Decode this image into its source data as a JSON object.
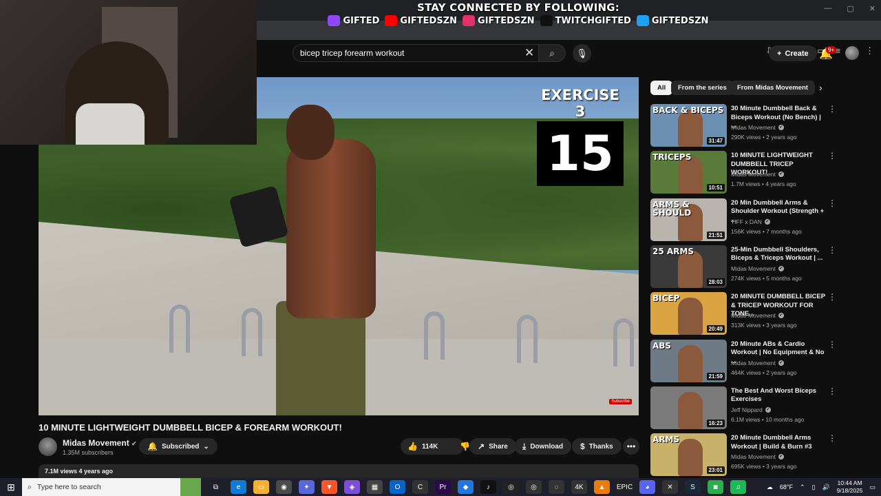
{
  "browser": {
    "window_controls": [
      "—",
      "▢",
      "✕"
    ],
    "toolbar_icons": [
      "install-icon",
      "star-icon",
      "extensions-icon",
      "cast-icon",
      "menu-icon"
    ]
  },
  "overlay": {
    "banner_title": "STAY CONNECTED BY FOLLOWING:",
    "socials": [
      {
        "platform": "twitch-icon",
        "handle": "GIFTED",
        "color": "#9146ff"
      },
      {
        "platform": "youtube-icon",
        "handle": "GIFTEDSZN",
        "color": "#ff0000"
      },
      {
        "platform": "instagram-icon",
        "handle": "GIFTEDSZN",
        "color": "#e1306c"
      },
      {
        "platform": "tiktok-icon",
        "handle": "TWITCHGIFTED",
        "color": "#111111"
      },
      {
        "platform": "twitter-icon",
        "handle": "GIFTEDSZN",
        "color": "#1da1f2"
      }
    ]
  },
  "header": {
    "search_query": "bicep tricep forearm workout",
    "clear_glyph": "✕",
    "search_glyph": "⌕",
    "mic_glyph": "🎙",
    "create_label": "Create",
    "create_glyph": "+",
    "notif_badge": "9+",
    "bell_glyph": "🔔"
  },
  "video": {
    "exercise_label": "EXERCISE 3",
    "exercise_count": "15",
    "watermark": "Subscribe",
    "title": "10 MINUTE LIGHTWEIGHT DUMBBELL BICEP & FOREARM WORKOUT!",
    "channel": "Midas Movement",
    "subscribers": "1.35M subscribers",
    "subscribed_label": "Subscribed",
    "likes": "114K",
    "share_label": "Share",
    "download_label": "Download",
    "thanks_label": "Thanks",
    "more_glyph": "•••",
    "views_line": "7.1M views  4 years ago"
  },
  "sidebar": {
    "chips": [
      "All",
      "From the series",
      "From Midas Movement"
    ],
    "next_glyph": "›",
    "recommendations": [
      {
        "title": "30 Minute Dumbbell Back & Biceps Workout (No Bench) | ...",
        "channel": "Midas Movement",
        "meta": "290K views • 2 years ago",
        "duration": "31:47",
        "thumb_text": "BACK & BICEPS",
        "thumb_bg": "#6b8fb0"
      },
      {
        "title": "10 MINUTE LIGHTWEIGHT DUMBBELL TRICEP WORKOUT!",
        "channel": "Midas Movement",
        "meta": "1.7M views • 4 years ago",
        "duration": "10:51",
        "thumb_text": "TRICEPS",
        "thumb_bg": "#5a7a3a"
      },
      {
        "title": "20 Min Dumbbell Arms & Shoulder Workout (Strength + ...",
        "channel": "TIFF x DAN",
        "meta": "156K views • 7 months ago",
        "duration": "21:51",
        "thumb_text": "ARMS & SHOULD",
        "thumb_bg": "#b9b4ad"
      },
      {
        "title": "25-Min Dumbbell Shoulders, Biceps & Triceps Workout | ...",
        "channel": "Midas Movement",
        "meta": "274K views • 5 months ago",
        "duration": "28:03",
        "thumb_text": "25 ARMS",
        "thumb_bg": "#3a3a3a"
      },
      {
        "title": "20 MINUTE DUMBBELL BICEP & TRICEP WORKOUT FOR TONE...",
        "channel": "Midas Movement",
        "meta": "313K views • 3 years ago",
        "duration": "20:49",
        "thumb_text": "BICEP",
        "thumb_bg": "#d9a441"
      },
      {
        "title": "20 Minute ABs & Cardio Workout | No Equipment & No ...",
        "channel": "Midas Movement",
        "meta": "464K views • 2 years ago",
        "duration": "21:59",
        "thumb_text": "ABS",
        "thumb_bg": "#6e7a86"
      },
      {
        "title": "The Best And Worst Biceps Exercises",
        "channel": "Jeff Nippard",
        "meta": "6.1M views • 10 months ago",
        "duration": "16:23",
        "thumb_text": "",
        "thumb_bg": "#7a7a7a"
      },
      {
        "title": "20 Minute Dumbbell Arms Workout | Build & Burn #3",
        "channel": "Midas Movement",
        "meta": "695K views • 3 years ago",
        "duration": "23:01",
        "thumb_text": "ARMS",
        "thumb_bg": "#c8b26a"
      }
    ]
  },
  "taskbar": {
    "search_placeholder": "Type here to search",
    "weather": "68°F",
    "time": "10:44 AM",
    "date": "9/18/2025",
    "apps": [
      {
        "name": "task-view-icon",
        "glyph": "⧉",
        "color": "#1f1f2b"
      },
      {
        "name": "edge-icon",
        "glyph": "e",
        "color": "#0f7bd6"
      },
      {
        "name": "file-explorer-icon",
        "glyph": "▭",
        "color": "#f2b134"
      },
      {
        "name": "chrome-icon",
        "glyph": "◉",
        "color": "#4a4a4a"
      },
      {
        "name": "copilot-icon",
        "glyph": "✦",
        "color": "#5a67d8"
      },
      {
        "name": "brave-icon",
        "glyph": "▼",
        "color": "#fb542b"
      },
      {
        "name": "office-icon",
        "glyph": "◈",
        "color": "#7b4fd6"
      },
      {
        "name": "calendar-icon",
        "glyph": "▦",
        "color": "#444"
      },
      {
        "name": "outlook-icon",
        "glyph": "O",
        "color": "#0a64c8"
      },
      {
        "name": "clipchamp-icon",
        "glyph": "C",
        "color": "#333"
      },
      {
        "name": "premiere-icon",
        "glyph": "Pr",
        "color": "#2a0a4a"
      },
      {
        "name": "app-icon",
        "glyph": "◆",
        "color": "#2277dd"
      },
      {
        "name": "tiktok-app-icon",
        "glyph": "♪",
        "color": "#111"
      },
      {
        "name": "obs-icon",
        "glyph": "◎",
        "color": "#222"
      },
      {
        "name": "app2-icon",
        "glyph": "◎",
        "color": "#333"
      },
      {
        "name": "app3-icon",
        "glyph": "◌",
        "color": "#333"
      },
      {
        "name": "4k-icon",
        "glyph": "4K",
        "color": "#333"
      },
      {
        "name": "vlc-icon",
        "glyph": "▲",
        "color": "#e87c0c"
      },
      {
        "name": "epic-icon",
        "glyph": "EPIC",
        "color": "#222"
      },
      {
        "name": "discord-icon",
        "glyph": "◕",
        "color": "#5865f2"
      },
      {
        "name": "xbox-icon",
        "glyph": "✕",
        "color": "#333"
      },
      {
        "name": "steam-icon",
        "glyph": "S",
        "color": "#1b2838"
      },
      {
        "name": "game-icon",
        "glyph": "◙",
        "color": "#2eab4f"
      },
      {
        "name": "spotify-icon",
        "glyph": "♫",
        "color": "#1db954"
      }
    ]
  }
}
